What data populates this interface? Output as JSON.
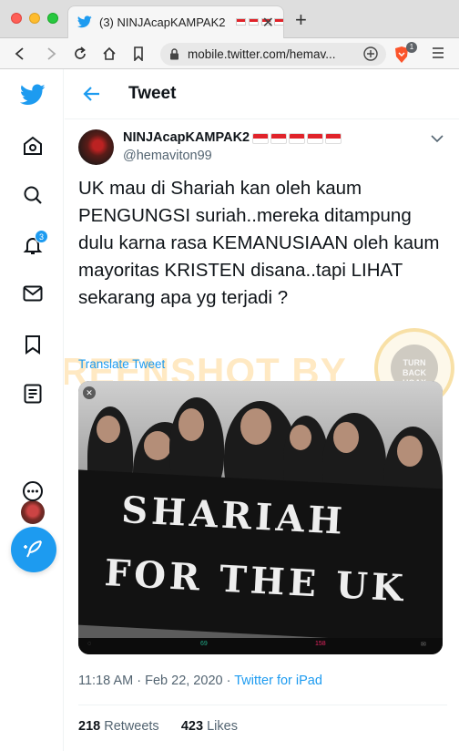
{
  "browser": {
    "tab_title": "(3) NINJAcapKAMPAK2",
    "tab_close": "✕",
    "new_tab": "+",
    "url": "mobile.twitter.com/hemav...",
    "brave_badge": "1"
  },
  "sidebar": {
    "notifications_badge": "3"
  },
  "header": {
    "title": "Tweet"
  },
  "tweet": {
    "display_name": "NINJAcapKAMPAK2",
    "handle": "@hemaviton99",
    "text": "UK mau di Shariah kan oleh kaum PENGUNGSI suriah..mereka ditampung dulu karna rasa KEMANUSIAAN oleh kaum mayoritas KRISTEN disana..tapi LIHAT sekarang apa yg terjadi ?",
    "translate_label": "Translate Tweet",
    "media": {
      "banner_line1": "SHARIAH",
      "banner_line2": "FOR THE UK",
      "close": "✕",
      "bar_retweets": "69",
      "bar_likes": "158"
    },
    "time": "11:18 AM",
    "date": "Feb 22, 2020",
    "separator": "·",
    "source": "Twitter for iPad",
    "retweets_count": "218",
    "retweets_label": "Retweets",
    "likes_count": "423",
    "likes_label": "Likes"
  },
  "watermark": {
    "text": "SCREENSHOT BY",
    "seal_text": "TURN BACK HOAX"
  },
  "colors": {
    "twitter_blue": "#1d9bf0",
    "text_primary": "#0f1419",
    "text_secondary": "#536471"
  }
}
